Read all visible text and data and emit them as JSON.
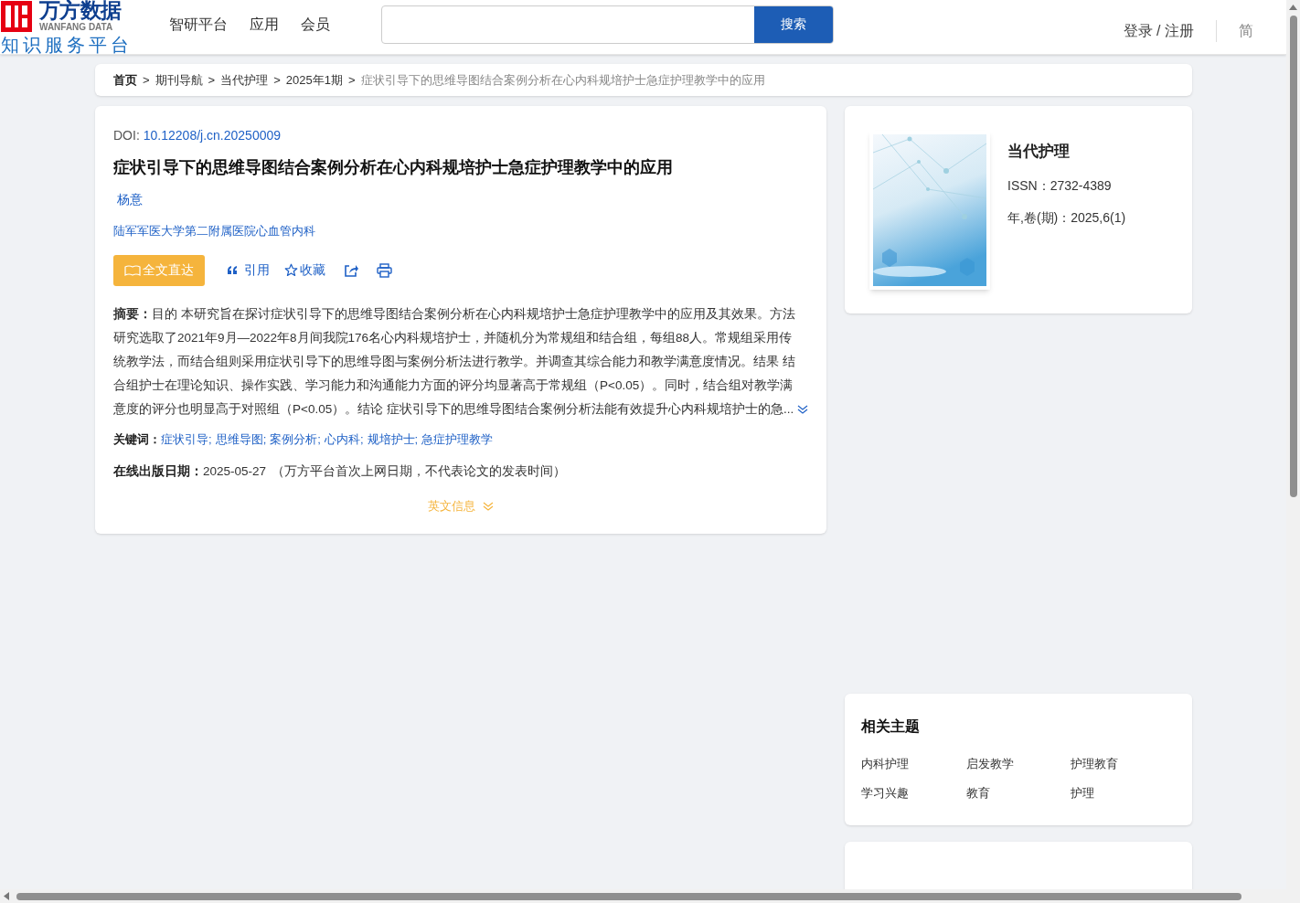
{
  "header": {
    "logo": {
      "name": "万方数据",
      "name_en": "WANFANG DATA",
      "slogan": "知识服务平台"
    },
    "nav": [
      "智研平台",
      "应用",
      "会员"
    ],
    "search": {
      "button": "搜索"
    },
    "login": "登录 / 注册",
    "language": {
      "label": "简",
      "selected": false
    }
  },
  "breadcrumb": [
    {
      "label": "首页",
      "current": false
    },
    {
      "label": "期刊导航",
      "current": false
    },
    {
      "label": "当代护理",
      "current": false
    },
    {
      "label": "2025年1期",
      "current": false
    },
    {
      "label": "症状引导下的思维导图结合案例分析在心内科规培护士急症护理教学中的应用",
      "current": true
    }
  ],
  "breadcrumb_separator": ">",
  "article": {
    "doi_label": "DOI:",
    "doi": "10.12208/j.cn.20250009",
    "title": "症状引导下的思维导图结合案例分析在心内科规培护士急症护理教学中的应用",
    "authors": [
      "杨意"
    ],
    "affiliation": "陆军军医大学第二附属医院心血管内科",
    "actions": [
      {
        "kind": "fulltext",
        "label": "全文直达"
      },
      {
        "kind": "cite",
        "label": "引用"
      },
      {
        "kind": "favorite",
        "label": "收藏"
      },
      {
        "kind": "share"
      },
      {
        "kind": "print"
      }
    ],
    "abstract": "**摘要：**目的 本研究旨在探讨症状引导下的思维导图结合案例分析在心内科规培护士急症护理教学中的应用及其效果。方法研究选取了2021年9月—2022年8月间我院176名心内科规培护士，并随机分为常规组和结合组，每组88人。常规组采用传统教学法，而结合组则采用症状引导下的思维导图与案例分析法进行教学。并调查其综合能力和教学满意度情况。结果 结合组护士在理论知识、操作实践、学习能力和沟通能力方面的评分均显著高于常规组（P<0.05）。同时，结合组对教学满意度的评分也明显高于对照组（P<0.05）。结论 症状引导下的思维导图结合案例分析法能有效提升心内科规培护士的急...",
    "keywords_label": "关键词：",
    "keyword_separator": ";",
    "keywords": [
      "症状引导",
      "思维导图",
      "案例分析",
      "心内科",
      "规培护士",
      "急症护理教学"
    ],
    "date_label": "在线出版日期：",
    "date": "2025-05-27",
    "date_note": "（万方平台首次上网日期，不代表论文的发表时间）",
    "english_toggle": "英文信息"
  },
  "journal": {
    "name": "当代护理",
    "issn": "ISSN：2732-4389",
    "issue": "年,卷(期)：2025,6(1)"
  },
  "related": {
    "title": "相关主题",
    "topics": [
      "内科护理",
      "启发教学",
      "护理教育",
      "学习兴趣",
      "教育",
      "护理"
    ]
  }
}
